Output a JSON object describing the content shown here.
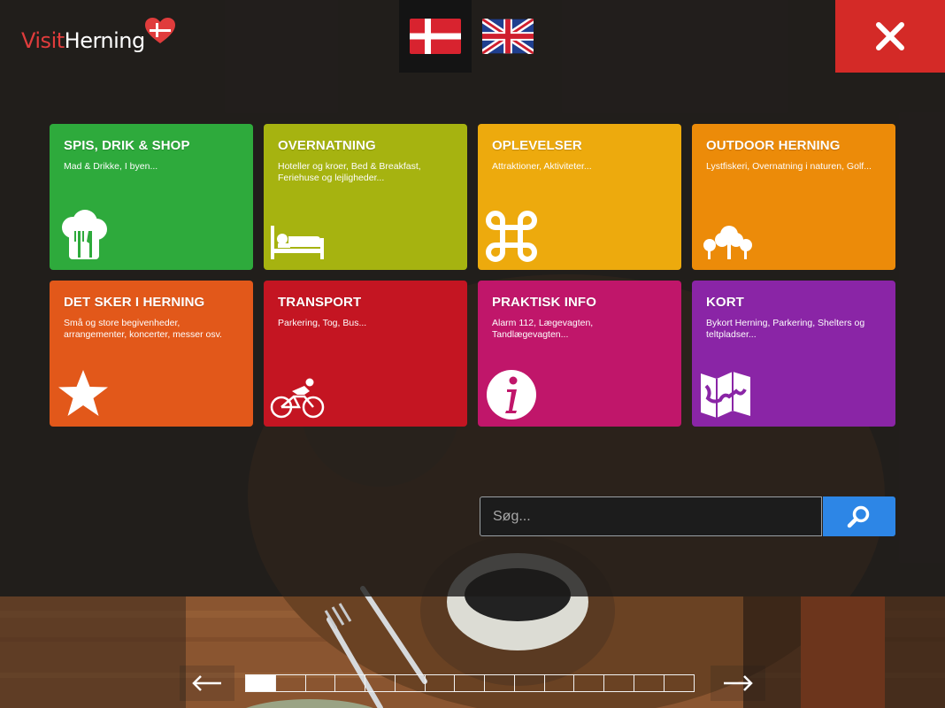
{
  "header": {
    "logo_visit": "Visit",
    "logo_herning": "Herning",
    "languages": [
      "Dansk",
      "English"
    ],
    "active_language": "Dansk"
  },
  "tiles": [
    {
      "title": "SPIS, DRIK & SHOP",
      "subtitle": "Mad & Drikke, I byen...",
      "color": "#2eaa3c",
      "icon": "chef-hat-icon"
    },
    {
      "title": "OVERNATNING",
      "subtitle": "Hoteller og kroer, Bed & Breakfast, Feriehuse og lejligheder...",
      "color": "#a6b310",
      "icon": "bed-icon"
    },
    {
      "title": "OPLEVELSER",
      "subtitle": "Attraktioner, Aktiviteter...",
      "color": "#edaa0d",
      "icon": "command-key-icon"
    },
    {
      "title": "OUTDOOR HERNING",
      "subtitle": "Lystfiskeri, Overnatning i naturen, Golf...",
      "color": "#ec8b09",
      "icon": "trees-icon"
    },
    {
      "title": "DET SKER I HERNING",
      "subtitle": "Små og store begivenheder, arrangementer, koncerter, messer osv.",
      "color": "#e2581a",
      "icon": "star-icon"
    },
    {
      "title": "TRANSPORT",
      "subtitle": "Parkering, Tog, Bus...",
      "color": "#c41522",
      "icon": "cyclist-icon"
    },
    {
      "title": "PRAKTISK INFO",
      "subtitle": "Alarm 112, Lægevagten, Tandlægevagten...",
      "color": "#c0166a",
      "icon": "info-icon"
    },
    {
      "title": "KORT",
      "subtitle": "Bykort Herning, Parkering, Shelters og teltpladser...",
      "color": "#8a25a6",
      "icon": "map-icon"
    }
  ],
  "search": {
    "placeholder": "Søg...",
    "button_icon": "search-icon",
    "button_color": "#2d86e6"
  },
  "pager": {
    "page_count": 15,
    "current_page": 1,
    "prev_icon": "arrow-left-icon",
    "next_icon": "arrow-right-icon"
  },
  "colors": {
    "close_button": "#d42a27",
    "logo_red": "#e03c3c"
  }
}
